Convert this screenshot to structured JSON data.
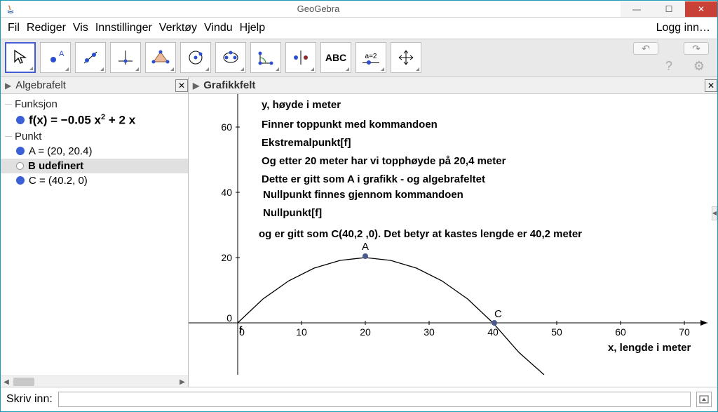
{
  "window": {
    "title": "GeoGebra"
  },
  "menu": {
    "fil": "Fil",
    "rediger": "Rediger",
    "vis": "Vis",
    "innstillinger": "Innstillinger",
    "verktoy": "Verktøy",
    "vindu": "Vindu",
    "hjelp": "Hjelp",
    "login": "Logg inn…"
  },
  "panels": {
    "algebra": "Algebrafelt",
    "graphics": "Grafikkfelt"
  },
  "algebra": {
    "section_funksjon": "Funksjon",
    "fx_prefix": "f(x)  =  −0.05 x",
    "fx_exp": "2",
    "fx_suffix": " + 2 x",
    "section_punkt": "Punkt",
    "pointA": "A = (20, 20.4)",
    "pointB": "B udefinert",
    "pointC": "C = (40.2, 0)"
  },
  "graphics": {
    "ylabel": "y, høyde i meter",
    "t1": "Finner toppunkt med kommandoen",
    "t2": "Ekstremalpunkt[f]",
    "t3": "Og etter 20 meter har vi topphøyde på 20,4 meter",
    "t4": "Dette er gitt som A i grafikk - og algebrafeltet",
    "t5": "Nullpunkt finnes gjennom kommandoen",
    "t6": "Nullpunkt[f]",
    "t7": " og er gitt som C(40,2 ,0). Det betyr at kastes lengde er 40,2 meter",
    "xlabel": "x, lengde i meter",
    "labelA": "A",
    "labelC": "C",
    "xticks": {
      "t0": "0",
      "t10": "10",
      "t20": "20",
      "t30": "30",
      "t40": "40",
      "t50": "50",
      "t60": "60",
      "t70": "70"
    },
    "yticks": {
      "y0": "0",
      "y20": "20",
      "y40": "40",
      "y60": "60"
    }
  },
  "input": {
    "label": "Skriv inn:",
    "value": ""
  },
  "tool_abc": "ABC",
  "tool_a2": "a=2",
  "chart_data": {
    "type": "line",
    "title": "",
    "xlabel": "x, lengde i meter",
    "ylabel": "y, høyde i meter",
    "xlim": [
      0,
      75
    ],
    "ylim": [
      0,
      70
    ],
    "function": "f(x) = -0.05 x^2 + 2 x",
    "x": [
      0,
      4,
      8,
      12,
      16,
      20,
      24,
      28,
      32,
      36,
      40,
      40.2
    ],
    "y": [
      0,
      7.2,
      12.8,
      16.8,
      19.2,
      20,
      19.2,
      16.8,
      12.8,
      7.2,
      0,
      -0.2
    ],
    "points": [
      {
        "name": "A",
        "x": 20,
        "y": 20.4
      },
      {
        "name": "C",
        "x": 40.2,
        "y": 0
      }
    ]
  }
}
